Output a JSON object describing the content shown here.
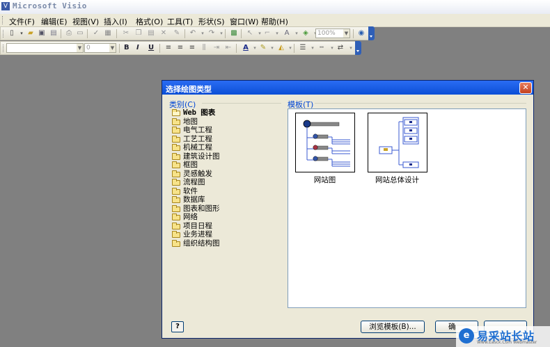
{
  "window": {
    "title": "Microsoft Visio",
    "icon": "visio-app-icon"
  },
  "menu": [
    {
      "label": "文件(F)"
    },
    {
      "label": "编辑(E)"
    },
    {
      "label": "视图(V)"
    },
    {
      "label": "插入(I)"
    },
    {
      "label": "格式(O)"
    },
    {
      "label": "工具(T)"
    },
    {
      "label": "形状(S)"
    },
    {
      "label": "窗口(W)"
    },
    {
      "label": "帮助(H)"
    }
  ],
  "toolbar": {
    "zoom": "100%",
    "font_name": "",
    "font_size": "0",
    "bold": "B",
    "italic": "I",
    "underline": "U",
    "font_color_glyph": "A"
  },
  "dialog": {
    "title": "选择绘图类型",
    "close_glyph": "✕",
    "category_label": "类别(C)",
    "template_label": "模板(T)",
    "categories": [
      {
        "label": "Web 图表",
        "selected": true
      },
      {
        "label": "地图"
      },
      {
        "label": "电气工程"
      },
      {
        "label": "工艺工程"
      },
      {
        "label": "机械工程"
      },
      {
        "label": "建筑设计图"
      },
      {
        "label": "框图"
      },
      {
        "label": "灵感触发"
      },
      {
        "label": "流程图"
      },
      {
        "label": "软件"
      },
      {
        "label": "数据库"
      },
      {
        "label": "图表和图形"
      },
      {
        "label": "网络"
      },
      {
        "label": "项目日程"
      },
      {
        "label": "业务进程"
      },
      {
        "label": "组织结构图"
      }
    ],
    "templates": [
      {
        "label": "网站图"
      },
      {
        "label": "网站总体设计"
      }
    ],
    "help_glyph": "?",
    "browse_button": "浏览模板(B)...",
    "ok_button": "确"
  },
  "watermark": {
    "text": "易采站长站",
    "sub": "Www.Easck.Com Webmaster",
    "logo": "e"
  },
  "colors": {
    "accent": "#0a246a",
    "title_blue": "#0b4fd6",
    "section_blue": "#0046d5"
  }
}
